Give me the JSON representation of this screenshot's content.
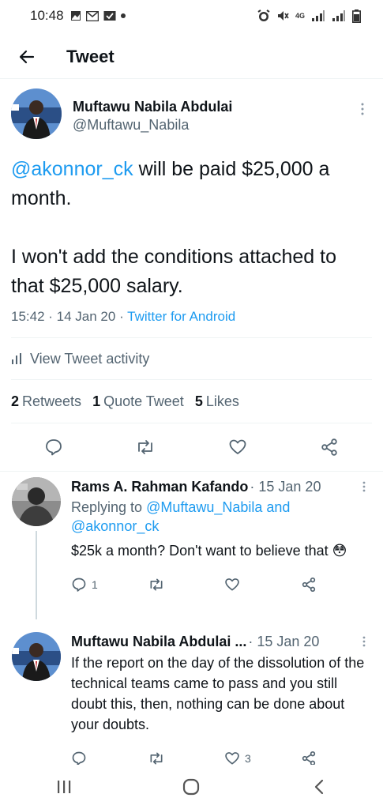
{
  "status_bar": {
    "time": "10:48",
    "network": "4G"
  },
  "header": {
    "title": "Tweet"
  },
  "main_tweet": {
    "author_name": "Muftawu Nabila Abdulai",
    "author_handle": "@Muftawu_Nabila",
    "mention": "@akonnor_ck",
    "text_line1_rest": " will be paid $25,000 a month.",
    "text_para2": "I won't add the conditions attached to that $25,000 salary.",
    "time": "15:42",
    "date": "14 Jan 20",
    "source": "Twitter for Android",
    "activity_label": "View Tweet activity",
    "stats": {
      "retweets_count": "2",
      "retweets_label": "Retweets",
      "quotes_count": "1",
      "quotes_label": "Quote Tweet",
      "likes_count": "5",
      "likes_label": "Likes"
    }
  },
  "replies": [
    {
      "name": "Rams A. Rahman Kafando",
      "date": "15 Jan 20",
      "replying_prefix": "Replying to ",
      "replying_to": "@Muftawu_Nabila and @akonnor_ck",
      "text": "$25k a month? Don't want to believe that 😳",
      "reply_count": "1",
      "like_count": ""
    },
    {
      "name": "Muftawu Nabila Abdulai ...",
      "date": "15 Jan 20",
      "text": "If the report on the day of the dissolution of the technical teams came to pass and you still doubt this, then, nothing can be done about your doubts.",
      "reply_count": "",
      "like_count": "3"
    }
  ],
  "colors": {
    "accent": "#1d9bf0",
    "text_primary": "#0f1419",
    "text_secondary": "#536471",
    "divider": "#eff3f4"
  },
  "icons": {
    "back": "arrow-left-icon",
    "more": "more-vertical-icon",
    "reply": "comment-icon",
    "retweet": "retweet-icon",
    "like": "heart-icon",
    "share": "share-icon",
    "activity": "bar-chart-icon"
  }
}
